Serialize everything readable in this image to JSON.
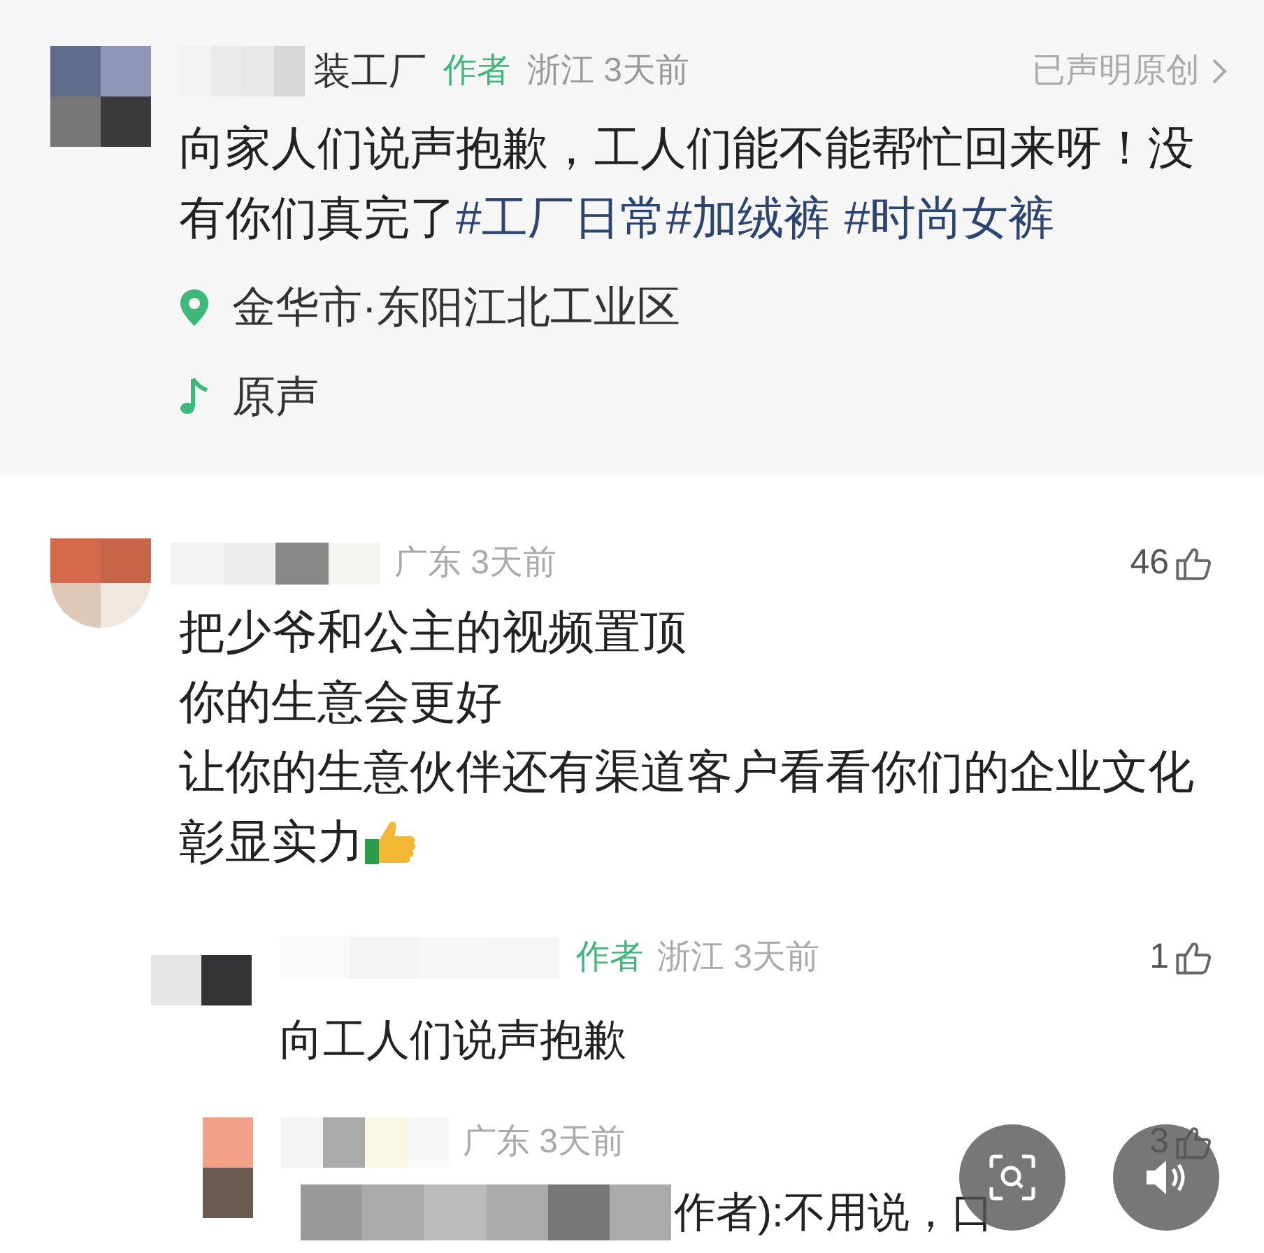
{
  "post": {
    "author": "装工厂",
    "author_badge": "作者",
    "region": "浙江",
    "time": "3天前",
    "original_declared": "已声明原创",
    "text": "向家人们说声抱歉，工人们能不能帮忙回来呀！没有你们真完了",
    "hashtags": [
      "#工厂日常",
      "#加绒裤",
      "#时尚女裤"
    ],
    "location": "金华市·东阳江北工业区",
    "music": "原声"
  },
  "comments": [
    {
      "region": "广东",
      "time": "3天前",
      "likes": "46",
      "lines": [
        "把少爷和公主的视频置顶",
        "你的生意会更好",
        "让你的生意伙伴还有渠道客户看看你们的企业文化",
        "彰显实力"
      ],
      "replies": [
        {
          "author_badge": "作者",
          "region": "浙江",
          "time": "3天前",
          "likes": "1",
          "text": "向工人们说声抱歉"
        },
        {
          "region": "广东",
          "time": "3天前",
          "likes": "3",
          "text": "作者):不用说，口"
        }
      ]
    }
  ],
  "overlay_buttons": [
    {
      "kind": "scan"
    },
    {
      "kind": "sound"
    }
  ]
}
